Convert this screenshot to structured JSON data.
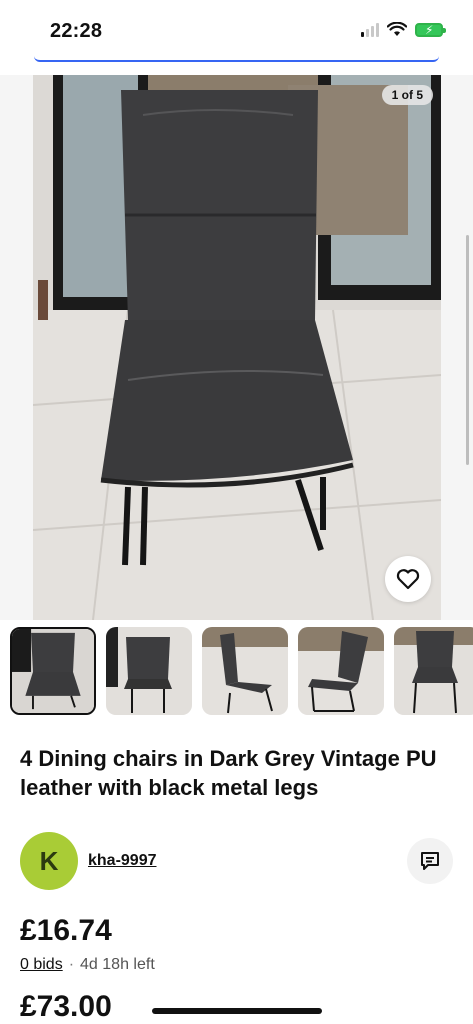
{
  "status_bar": {
    "time": "22:28"
  },
  "gallery": {
    "counter": "1 of 5",
    "thumbnail_count": 5
  },
  "listing": {
    "title": "4 Dining chairs in Dark Grey Vintage PU leather with black metal legs",
    "seller": {
      "initial": "K",
      "username": "kha-9997"
    },
    "current_price": "£16.74",
    "bids": "0 bids",
    "separator": "·",
    "time_left": "4d 18h left",
    "buy_it_now_price": "£73.00"
  },
  "colors": {
    "accent": "#3665f3",
    "avatar": "#a9cc36",
    "chair_leather": "#3d3d3f"
  },
  "icons": {
    "heart": "heart-icon",
    "message": "message-icon",
    "wifi": "wifi-icon",
    "battery": "battery-charging-icon"
  }
}
